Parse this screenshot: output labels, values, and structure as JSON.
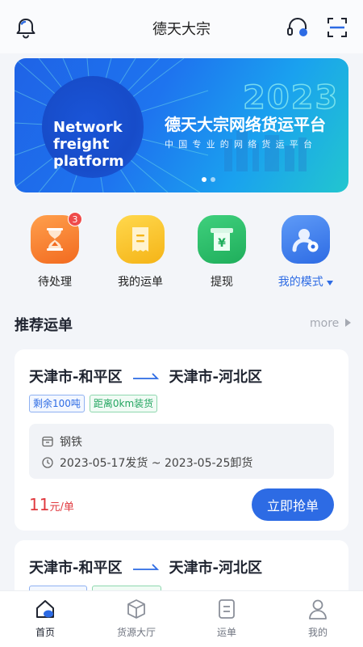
{
  "header": {
    "title": "德天大宗",
    "left_icon": "bell-icon",
    "right_icons": [
      "headset-icon",
      "scan-icon"
    ]
  },
  "banner": {
    "badge_line1": "Network",
    "badge_line2": "freight",
    "badge_line3": "platform",
    "year": "2023",
    "title": "德天大宗网络货运平台",
    "subtitle": "中国专业的网络货运平台",
    "page_count": 2
  },
  "quick_menu": [
    {
      "label": "待处理",
      "icon": "hourglass-icon",
      "badge": "3"
    },
    {
      "label": "我的运单",
      "icon": "waybill-icon"
    },
    {
      "label": "提现",
      "icon": "withdraw-icon"
    },
    {
      "label": "我的模式",
      "icon": "user-settings-icon",
      "dropdown": true
    }
  ],
  "recommend": {
    "title": "推荐运单",
    "more_label": "more"
  },
  "orders": [
    {
      "from": "天津市-和平区",
      "to": "天津市-河北区",
      "tag_remaining": "剩余100吨",
      "tag_distance": "距离0km装货",
      "cargo": "钢铁",
      "schedule": "2023-05-17发货 ~ 2023-05-25卸货",
      "price": "11",
      "price_unit": "元/单",
      "action": "立即抢单"
    },
    {
      "from": "天津市-和平区",
      "to": "天津市-河北区"
    }
  ],
  "tabs": [
    {
      "label": "首页",
      "icon": "home-icon",
      "active": true
    },
    {
      "label": "货源大厅",
      "icon": "box-icon"
    },
    {
      "label": "运单",
      "icon": "document-icon"
    },
    {
      "label": "我的",
      "icon": "person-icon"
    }
  ],
  "colors": {
    "accent": "#2d6be4",
    "price": "#e0383e",
    "badge": "#ef4b4b"
  }
}
